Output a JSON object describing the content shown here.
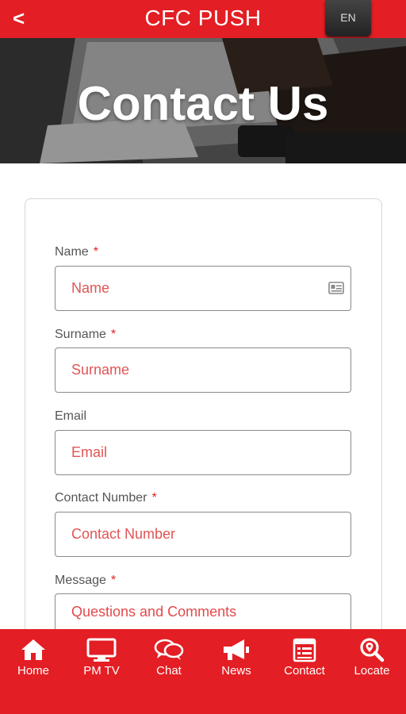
{
  "header": {
    "back_glyph": "<",
    "title": "CFC PUSH",
    "lang": "EN"
  },
  "hero": {
    "title": "Contact Us"
  },
  "form": {
    "fields": [
      {
        "label": "Name",
        "required": "*",
        "placeholder": "Name"
      },
      {
        "label": "Surname",
        "required": "*",
        "placeholder": "Surname"
      },
      {
        "label": "Email",
        "required": "",
        "placeholder": "Email"
      },
      {
        "label": "Contact Number",
        "required": "*",
        "placeholder": "Contact Number"
      },
      {
        "label": "Message",
        "required": "*",
        "placeholder": "Questions and Comments"
      }
    ]
  },
  "nav": {
    "items": [
      {
        "label": "Home",
        "icon": "home-icon"
      },
      {
        "label": "PM TV",
        "icon": "tv-icon"
      },
      {
        "label": "Chat",
        "icon": "chat-icon"
      },
      {
        "label": "News",
        "icon": "megaphone-icon"
      },
      {
        "label": "Contact",
        "icon": "contact-form-icon"
      },
      {
        "label": "Locate",
        "icon": "locate-search-icon"
      }
    ]
  },
  "colors": {
    "brand_red": "#e31e24",
    "placeholder_red": "#e05555",
    "lang_button": "#333333"
  }
}
